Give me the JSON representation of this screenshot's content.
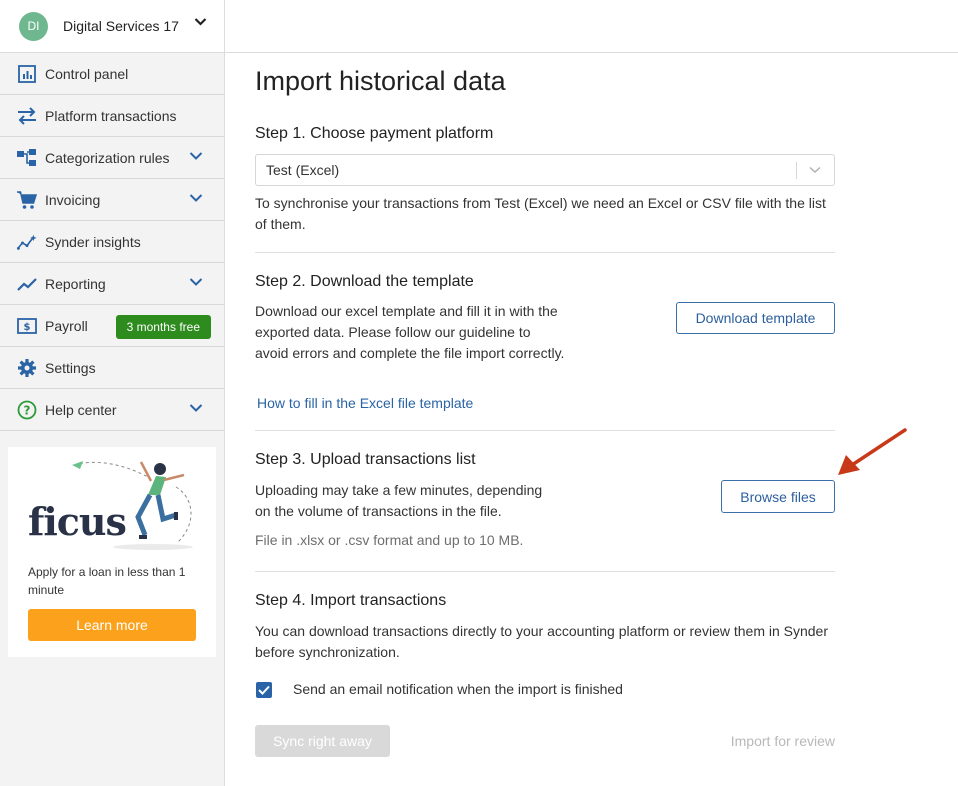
{
  "org": {
    "initials": "DI",
    "name": "Digital Services 17"
  },
  "nav": [
    {
      "label": "Control panel",
      "icon": "chart-icon"
    },
    {
      "label": "Platform transactions",
      "icon": "transfer-arrows-icon"
    },
    {
      "label": "Categorization rules",
      "icon": "hierarchy-icon",
      "expandable": true
    },
    {
      "label": "Invoicing",
      "icon": "cart-icon",
      "expandable": true
    },
    {
      "label": "Synder insights",
      "icon": "insights-icon"
    },
    {
      "label": "Reporting",
      "icon": "trend-icon",
      "expandable": true
    },
    {
      "label": "Payroll",
      "icon": "payroll-icon",
      "badge": "3 months free"
    },
    {
      "label": "Settings",
      "icon": "gear-icon"
    },
    {
      "label": "Help center",
      "icon": "question-icon",
      "expandable": true
    }
  ],
  "promo": {
    "brand": "ficus",
    "text": "Apply for a loan in less than 1 minute",
    "button": "Learn more"
  },
  "page": {
    "title": "Import historical data",
    "step1": {
      "title": "Step 1. Choose payment platform",
      "selected": "Test (Excel)",
      "description": "To synchronise your transactions from Test (Excel) we need an Excel or CSV file with the list of them."
    },
    "step2": {
      "title": "Step 2. Download the template",
      "description": "Download our excel template and fill it in with the exported data. Please follow our guideline to avoid errors and complete the file import correctly.",
      "button": "Download template",
      "link": "How to fill in the Excel file template"
    },
    "step3": {
      "title": "Step 3. Upload transactions list",
      "description": "Uploading may take a few minutes, depending on the volume of transactions in the file.",
      "note": "File in .xlsx or .csv format and up to 10 MB.",
      "button": "Browse files"
    },
    "step4": {
      "title": "Step 4. Import transactions",
      "description": "You can download transactions directly to your accounting platform or review them in Synder before synchronization.",
      "checkbox_label": "Send an email notification when the import is finished",
      "checkbox_checked": true,
      "sync_button": "Sync right away",
      "review_link": "Import for review"
    }
  },
  "colors": {
    "accent": "#2a64a6",
    "badge": "#2e8b1e",
    "promo_button": "#fba11b",
    "annotation_arrow": "#c8391a"
  }
}
